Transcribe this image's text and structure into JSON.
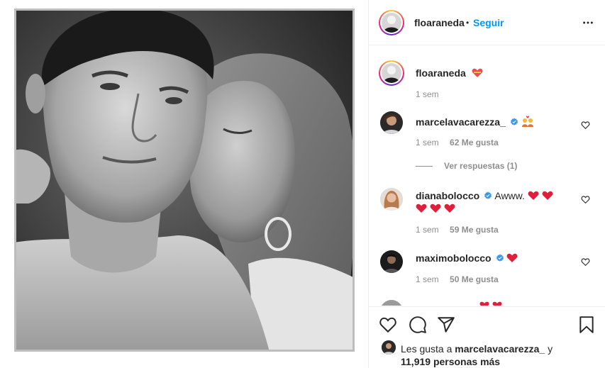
{
  "post": {
    "author": "floaraneda",
    "separator": "•",
    "follow_label": "Seguir"
  },
  "caption": {
    "username": "floaraneda",
    "emoji": "heart-with-ribbon",
    "time": "1 sem"
  },
  "comments": [
    {
      "username": "marcelavacarezza_",
      "verified": true,
      "text": "",
      "emoji": "couple-with-heart",
      "time": "1 sem",
      "likes": "62 Me gusta",
      "view_replies": "Ver respuestas (1)"
    },
    {
      "username": "dianabolocco",
      "verified": true,
      "text": "Awww.",
      "emoji": "red-hearts",
      "time": "1 sem",
      "likes": "59 Me gusta"
    },
    {
      "username": "maximobolocco",
      "verified": true,
      "text": "",
      "emoji": "red-heart",
      "time": "1 sem",
      "likes": "50 Me gusta"
    }
  ],
  "likes_summary": {
    "prefix": "Les gusta a",
    "user": "marcelavacarezza_",
    "conj": "y",
    "count": "11,919 personas más"
  },
  "icons": {
    "more": "more-options-icon",
    "like": "heart-outline-icon",
    "comment": "comment-icon",
    "share": "share-icon",
    "save": "bookmark-icon",
    "verified": "verified-badge-icon"
  },
  "colors": {
    "accent": "#0095f6",
    "text": "#262626",
    "muted": "#8e8e8e",
    "border": "#efefef",
    "heart": "#ed4956",
    "verified": "#3897f0"
  }
}
